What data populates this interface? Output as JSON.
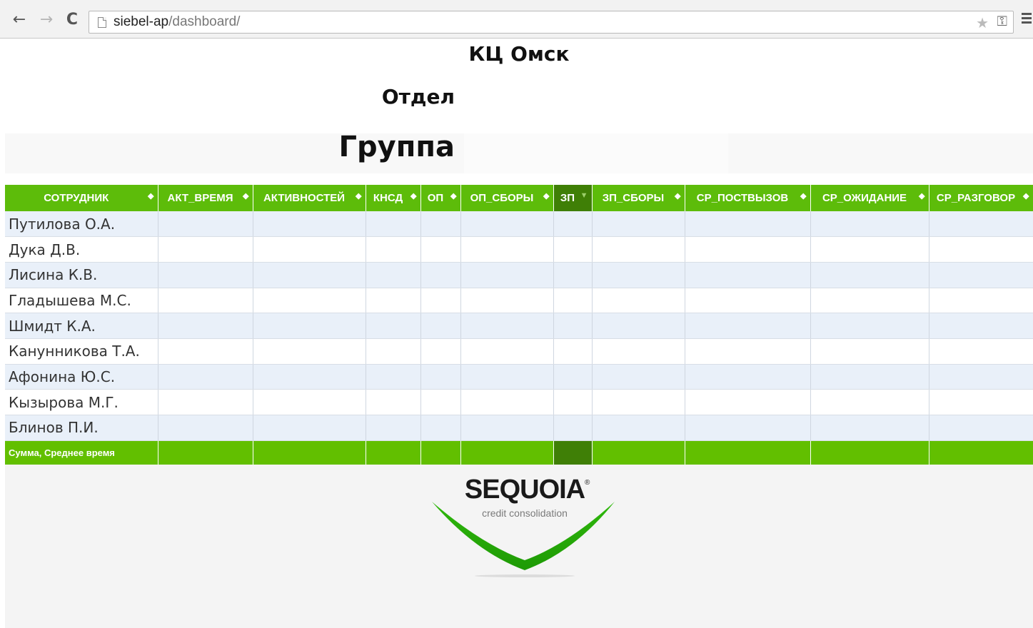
{
  "browser": {
    "url_host": "siebel-ap",
    "url_path": "/dashboard/"
  },
  "page": {
    "title": "КЦ Омск",
    "department": "Отдел",
    "group": "Группа"
  },
  "table": {
    "columns": [
      "СОТРУДНИК",
      "АКТ_ВРЕМЯ",
      "АКТИВНОСТЕЙ",
      "КНСД",
      "ОП",
      "ОП_СБОРЫ",
      "ЗП",
      "ЗП_СБОРЫ",
      "СР_ПОСТВЫЗОВ",
      "СР_ОЖИДАНИЕ",
      "СР_РАЗГОВОР"
    ],
    "sorted_column": "ЗП",
    "rows": [
      "Путилова О.А.",
      "Дука Д.В.",
      "Лисина К.В.",
      "Гладышева М.С.",
      "Шмидт К.А.",
      "Канунникова Т.А.",
      "Афонина Ю.С.",
      "Кызырова М.Г.",
      "Блинов П.И."
    ],
    "total_label": "Сумма, Среднее время"
  },
  "logo": {
    "name": "SEQUOIA",
    "tagline": "credit consolidation",
    "registered_mark": "®"
  },
  "colors": {
    "header_green": "#5dbc0a",
    "active_green": "#3f7f06",
    "total_green": "#62bf00",
    "odd_row": "#e9f0f9"
  },
  "icons": {
    "back": "back-arrow-icon",
    "forward": "forward-arrow-icon",
    "reload": "reload-icon",
    "page": "page-icon",
    "bookmark": "star-icon",
    "key": "key-icon",
    "menu": "menu-icon",
    "sort": "sort-icon"
  }
}
